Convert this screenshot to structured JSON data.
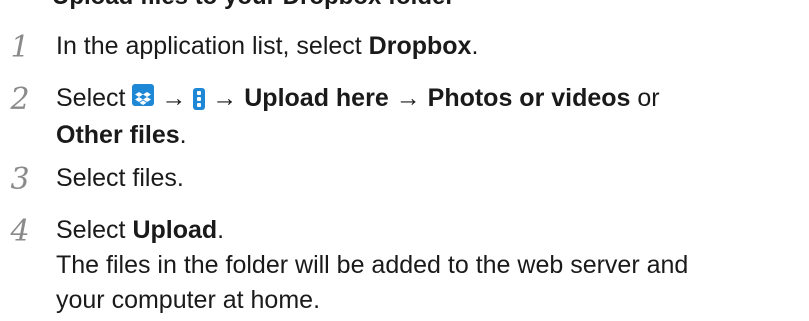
{
  "heading": "Upload files to your Dropbox folder",
  "steps": [
    {
      "number": "1",
      "prefix": "In the application list, select ",
      "bold": "Dropbox",
      "suffix": "."
    },
    {
      "number": "2",
      "select": "Select",
      "arrow": "→",
      "upload_here": "Upload here",
      "photos_or_videos": "Photos or videos",
      "or": "or",
      "other_files": "Other files",
      "period": "."
    },
    {
      "number": "3",
      "text": "Select files."
    },
    {
      "number": "4",
      "prefix": "Select ",
      "bold": "Upload",
      "suffix": ".",
      "note_line1": "The files in the folder will be added to the web server and",
      "note_line2": "your computer at home."
    }
  ],
  "icons": {
    "dropbox": "dropbox-icon",
    "menu": "more-options-icon",
    "icon_color": "#1e88d6"
  }
}
